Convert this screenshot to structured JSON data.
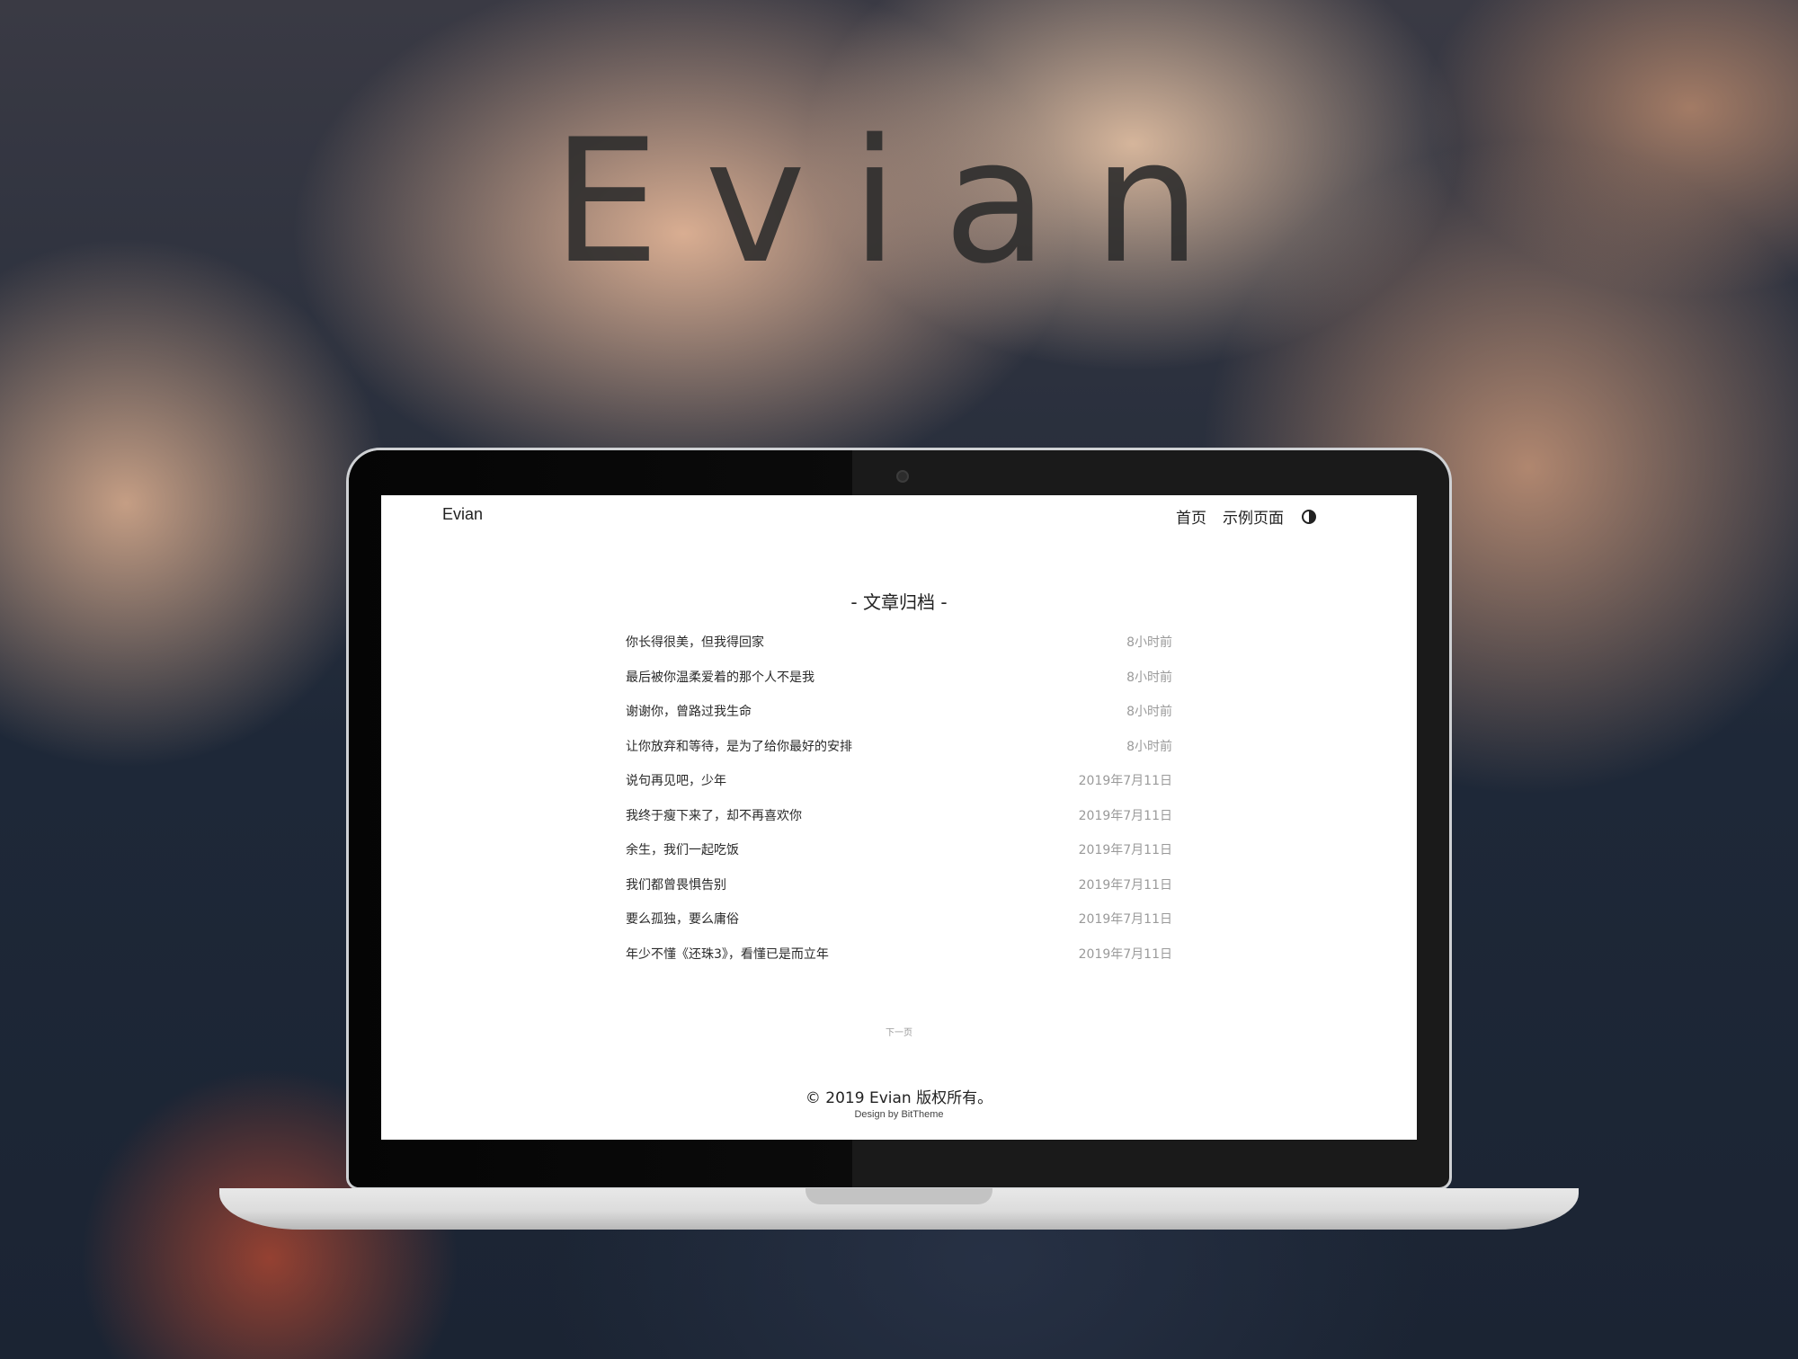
{
  "hero": {
    "title": "Evian"
  },
  "site": {
    "brand": "Evian",
    "nav": [
      {
        "label": "首页"
      },
      {
        "label": "示例页面"
      }
    ],
    "theme_toggle_icon": "contrast-icon"
  },
  "archive": {
    "heading": "- 文章归档 -",
    "posts": [
      {
        "title": "你长得很美，但我得回家",
        "date": "8小时前"
      },
      {
        "title": "最后被你温柔爱着的那个人不是我",
        "date": "8小时前"
      },
      {
        "title": "谢谢你，曾路过我生命",
        "date": "8小时前"
      },
      {
        "title": "让你放弃和等待，是为了给你最好的安排",
        "date": "8小时前"
      },
      {
        "title": "说句再见吧，少年",
        "date": "2019年7月11日"
      },
      {
        "title": "我终于瘦下来了，却不再喜欢你",
        "date": "2019年7月11日"
      },
      {
        "title": "余生，我们一起吃饭",
        "date": "2019年7月11日"
      },
      {
        "title": "我们都曾畏惧告别",
        "date": "2019年7月11日"
      },
      {
        "title": "要么孤独，要么庸俗",
        "date": "2019年7月11日"
      },
      {
        "title": "年少不懂《还珠3》，看懂已是而立年",
        "date": "2019年7月11日"
      }
    ],
    "next_page": "下一页"
  },
  "footer": {
    "copyright": "© 2019 Evian 版权所有。",
    "design_by": "Design by BitTheme"
  }
}
